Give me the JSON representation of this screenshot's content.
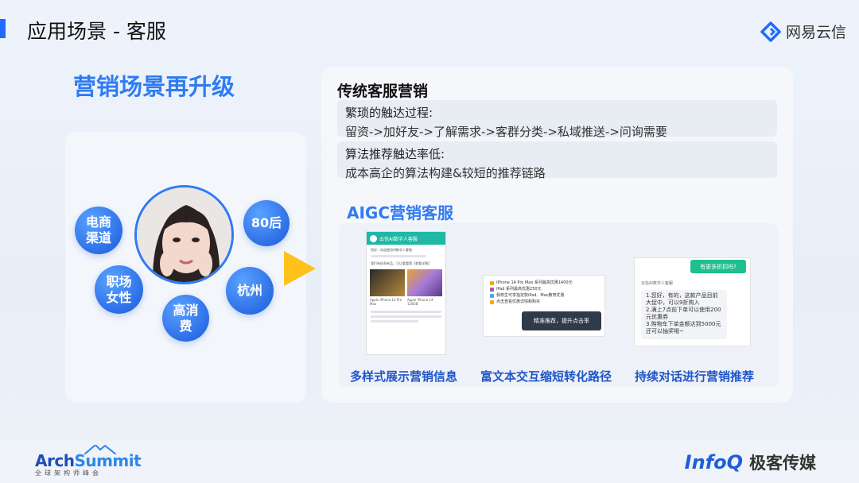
{
  "header": {
    "title": "应用场景 - 客服",
    "brand": "网易云信",
    "brand_icon": "netease-yunxin-logo-icon",
    "accent": "#1f6bff"
  },
  "subtitle": "营销场景再升级",
  "persona": {
    "tags": [
      "电商\n渠道",
      "80后",
      "职场\n女性",
      "杭州",
      "高消\n费"
    ]
  },
  "traditional": {
    "title": "传统客服营销",
    "items": [
      {
        "head": "繁琐的触达过程:",
        "detail": "留资->加好友->了解需求->客群分类->私域推送->问询需要"
      },
      {
        "head": "算法推荐触达率低:",
        "detail": "成本高企的算法构建&较短的推荐链路"
      }
    ]
  },
  "aigc": {
    "title": "AIGC营销客服",
    "captions": [
      "多样式展示营销信息",
      "富文本交互缩短转化路径",
      "持续对话进行营销推荐"
    ],
    "phone": {
      "header": "云信AI数字人客服",
      "msg1": "您好，欢迎使用AI数字人客服",
      "msg2": "我们有很多新品，可以看看哦【查看详情】",
      "card1": "Apple iPhone 14 Pro Max",
      "card2": "Apple iPhone 14 128GB"
    },
    "rich": {
      "rows": [
        "iPhone 14 Pro Max 系列最高优惠1400元",
        "iPad 系列最高优惠250元",
        "我校生可享指定款iPad、Mac教育优惠",
        "点击查看优惠详情和购买"
      ],
      "button": "精准推荐，提升点击率"
    },
    "dialog": {
      "question": "有更多折扣吗?",
      "sender": "云信AI数字人客服",
      "answer": "1.您好，有的，这款产品目前大促中，可以9折购入\n2.满上7点前下单可以使用200元优惠券\n3.购物车下单金额达到5000元还可以抽奖哦~"
    }
  },
  "footer": {
    "arch_name_1": "Arch",
    "arch_name_2": "Summit",
    "arch_sub": "全球架构师峰会",
    "infoq": "InfoQ",
    "infoq_cn": "极客传媒"
  }
}
